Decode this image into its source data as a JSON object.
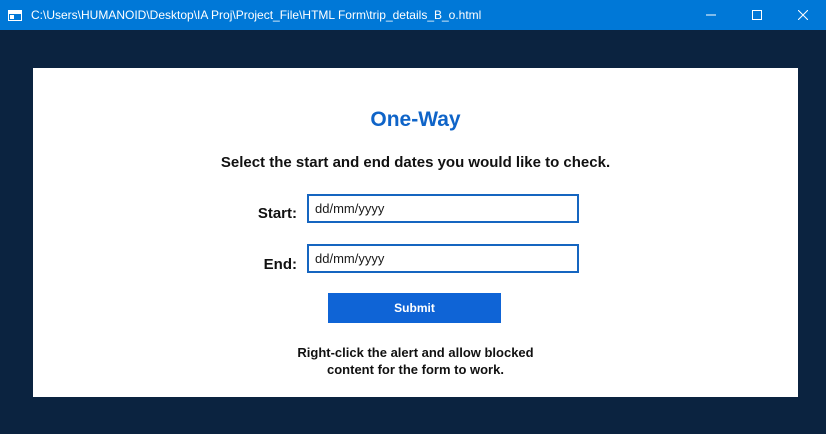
{
  "window": {
    "title": "C:\\Users\\HUMANOID\\Desktop\\IA Proj\\Project_File\\HTML Form\\trip_details_B_o.html",
    "icon": "app-window-icon",
    "controls": [
      "minimize-icon",
      "maximize-icon",
      "close-icon"
    ]
  },
  "form": {
    "heading": "One-Way",
    "subtitle": "Select the start and end dates you would like to check.",
    "start_label": "Start:",
    "start_placeholder": "dd/mm/yyyy",
    "start_value": "",
    "end_label": "End:",
    "end_placeholder": "dd/mm/yyyy",
    "end_value": "",
    "submit_label": "Submit",
    "note_line1": "Right-click the alert and allow blocked",
    "note_line2": "content for the form to work."
  },
  "colors": {
    "titlebar": "#0078d7",
    "background": "#0b2340",
    "card": "#ffffff",
    "accent": "#0f64c8",
    "button": "#0f64d6"
  }
}
